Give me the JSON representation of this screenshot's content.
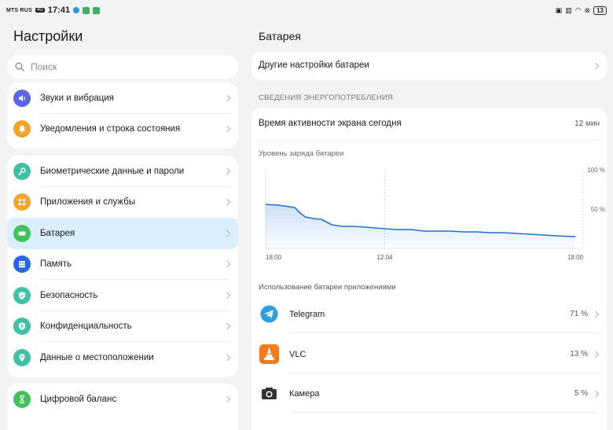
{
  "status": {
    "carrier": "MTS RUS",
    "network": "4G",
    "time": "17:41",
    "battery": "13"
  },
  "left": {
    "title": "Настройки",
    "search_placeholder": "Поиск",
    "group1": [
      {
        "label": "Звуки и вибрация",
        "icon": "speaker-icon",
        "color": "#5b63e6"
      },
      {
        "label": "Уведомления и строка состояния",
        "icon": "bell-icon",
        "color": "#f2a52b"
      }
    ],
    "group2": [
      {
        "label": "Биометрические данные и пароли",
        "icon": "key-icon",
        "color": "#42c0a3"
      },
      {
        "label": "Приложения и службы",
        "icon": "apps-icon",
        "color": "#f2a52b"
      },
      {
        "label": "Батарея",
        "icon": "battery-icon",
        "color": "#43c15d"
      },
      {
        "label": "Память",
        "icon": "storage-icon",
        "color": "#2a66e0"
      },
      {
        "label": "Безопасность",
        "icon": "shield-icon",
        "color": "#42c0a3"
      },
      {
        "label": "Конфиденциальность",
        "icon": "privacy-icon",
        "color": "#42c0a3"
      },
      {
        "label": "Данные о местоположении",
        "icon": "location-pin-icon",
        "color": "#42c0a3"
      }
    ],
    "group3": [
      {
        "label": "Цифровой баланс",
        "icon": "hourglass-icon",
        "color": "#43c15d"
      }
    ]
  },
  "right": {
    "title": "Батарея",
    "other_settings": "Другие настройки батареи",
    "section_header": "СВЕДЕНИЯ ЭНЕРГОПОТРЕБЛЕНИЯ",
    "screen_time_label": "Время активности экрана сегодня",
    "screen_time_value": "12 мин",
    "chart_label": "Уровень заряда батареи",
    "apps_label": "Использование батареи приложениями",
    "apps": [
      {
        "name": "Telegram",
        "percent": "71 %",
        "icon": "telegram-icon"
      },
      {
        "name": "VLC",
        "percent": "13 %",
        "icon": "vlc-icon"
      },
      {
        "name": "Камера",
        "percent": "5 %",
        "icon": "camera-icon"
      }
    ]
  },
  "chart_data": {
    "type": "line",
    "title": "Уровень заряда батареи",
    "xlabel": "",
    "ylabel": "",
    "x_ticks": [
      "18:00",
      "12.04",
      "18:00"
    ],
    "y_ticks": [
      "100 %",
      "50 %"
    ],
    "ylim": [
      0,
      100
    ],
    "x_range": [
      0,
      24
    ],
    "grid": true,
    "series": [
      {
        "x": [
          0,
          1,
          1.8,
          2.2,
          2.6,
          3.0,
          3.6,
          4.2,
          5.0,
          5.8,
          6.6,
          7.6,
          9,
          10,
          11,
          12,
          13,
          14,
          15,
          16,
          17,
          18,
          19,
          20,
          21,
          22,
          23.4
        ],
        "y": [
          56,
          55,
          53,
          52,
          45,
          40,
          38,
          37,
          30,
          28,
          28,
          27,
          25,
          24,
          24,
          22,
          22,
          22,
          21,
          21,
          20,
          20,
          19,
          18,
          17,
          16,
          15
        ]
      }
    ]
  }
}
